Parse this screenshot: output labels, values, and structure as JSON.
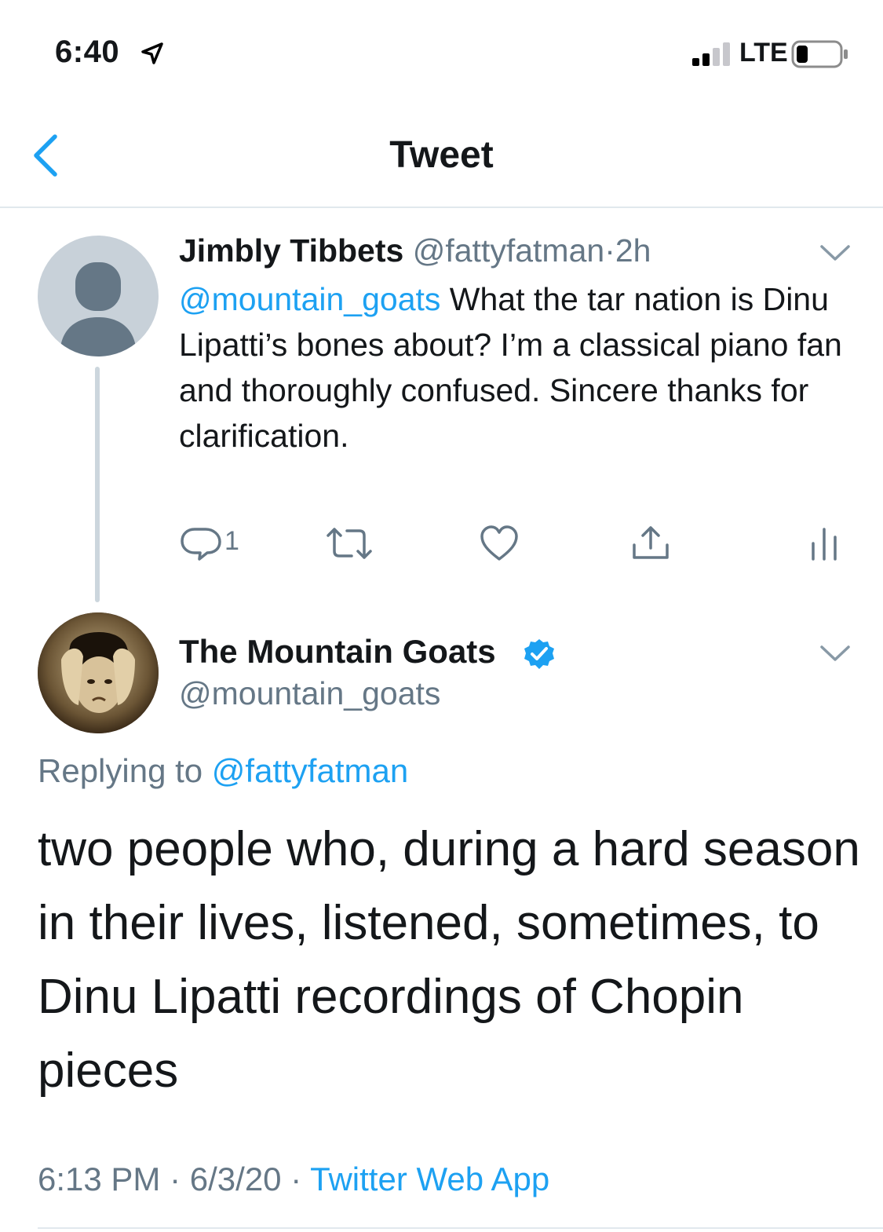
{
  "status_bar": {
    "time": "6:40",
    "network": "LTE",
    "location_icon": "location-arrow-icon",
    "signal_bars_active": 2,
    "signal_bars_total": 4,
    "battery_level": 0.25
  },
  "nav": {
    "title": "Tweet",
    "back_icon": "chevron-left-icon"
  },
  "colors": {
    "link": "#1da1f2",
    "secondary_text": "#657786",
    "primary_text": "#14171a",
    "divider": "#e1e8ed"
  },
  "reply_tweet": {
    "name": "Jimbly Tibbets",
    "handle": "@fattyfatman",
    "separator": "·",
    "time": "2h",
    "mention": "@mountain_goats",
    "text": " What the tar nation is Dinu Lipatti’s bones about? I’m a classical piano fan and thoroughly confused. Sincere thanks for clarification.",
    "reply_count": "1",
    "actions": [
      "reply-icon",
      "retweet-icon",
      "like-icon",
      "share-icon",
      "analytics-icon"
    ]
  },
  "main_tweet": {
    "name": "The Mountain Goats",
    "handle": "@mountain_goats",
    "verified": true,
    "replying_prefix": "Replying to ",
    "replying_handle": "@fattyfatman",
    "text": "two people who, during a hard season in their lives, listened, sometimes, to Dinu Lipatti recordings of Chopin pieces",
    "time": "6:13 PM",
    "date": "6/3/20",
    "separator": "·",
    "source": "Twitter Web App"
  }
}
